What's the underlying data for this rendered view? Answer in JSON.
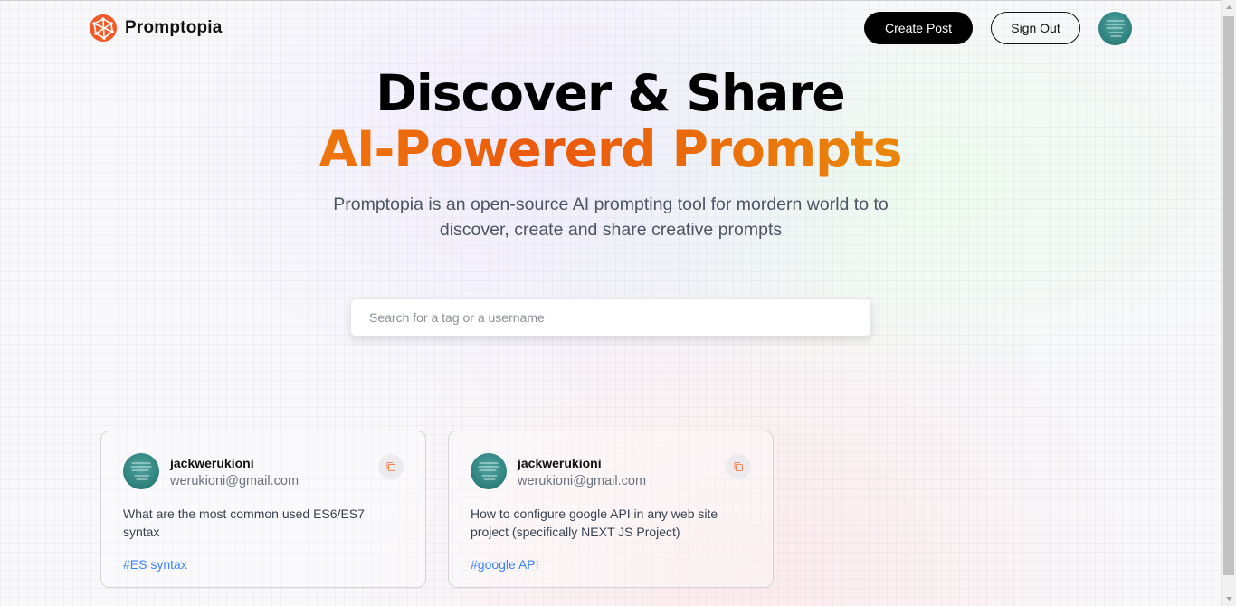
{
  "nav": {
    "brand": "Promptopia",
    "create_label": "Create Post",
    "signout_label": "Sign Out",
    "logo_icon": "network-globe-icon",
    "avatar_icon": "user-avatar"
  },
  "hero": {
    "title_line1": "Discover & Share",
    "title_line2": "AI-Powererd Prompts",
    "description": "Promptopia is an open-source AI prompting tool for mordern world to to discover, create and share creative prompts"
  },
  "search": {
    "value": "",
    "placeholder": "Search for a tag or a username"
  },
  "cards": [
    {
      "username": "jackwerukioni",
      "email": "werukioni@gmail.com",
      "prompt": "What are the most common used ES6/ES7 syntax",
      "tag": "#ES syntax"
    },
    {
      "username": "jackwerukioni",
      "email": "werukioni@gmail.com",
      "prompt": "How to configure google API in any web site project (specifically NEXT JS Project)",
      "tag": "#google API"
    }
  ],
  "colors": {
    "accent_orange": "#ea580c",
    "gradient_start": "#f59e0b",
    "gradient_end": "#eab308",
    "tag_blue": "#3b82f6",
    "primary_button": "#000000"
  }
}
